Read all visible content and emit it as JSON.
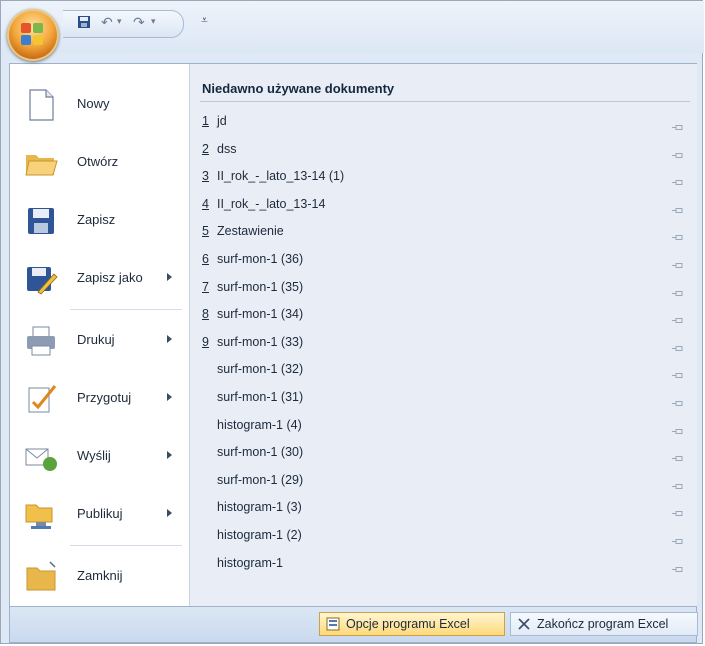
{
  "quick_access": {
    "save_icon": "floppy-disk-icon",
    "undo_icon": "undo-icon",
    "redo_icon": "redo-icon",
    "customize_icon": "customize-arrow-icon"
  },
  "commands": [
    {
      "label": "Nowy",
      "icon": "new-document-icon",
      "submenu": false
    },
    {
      "label": "Otwórz",
      "icon": "open-folder-icon",
      "submenu": false
    },
    {
      "label": "Zapisz",
      "icon": "save-icon",
      "submenu": false
    },
    {
      "label": "Zapisz jako",
      "icon": "save-as-icon",
      "submenu": true
    },
    {
      "label": "Drukuj",
      "icon": "printer-icon",
      "submenu": true
    },
    {
      "label": "Przygotuj",
      "icon": "prepare-icon",
      "submenu": true
    },
    {
      "label": "Wyślij",
      "icon": "send-icon",
      "submenu": true
    },
    {
      "label": "Publikuj",
      "icon": "publish-icon",
      "submenu": true
    },
    {
      "label": "Zamknij",
      "icon": "close-folder-icon",
      "submenu": false
    }
  ],
  "recent": {
    "title": "Niedawno używane dokumenty",
    "documents": [
      {
        "num": "1",
        "name": "jd"
      },
      {
        "num": "2",
        "name": "dss"
      },
      {
        "num": "3",
        "name": "II_rok_-_lato_13-14 (1)"
      },
      {
        "num": "4",
        "name": "II_rok_-_lato_13-14"
      },
      {
        "num": "5",
        "name": "Zestawienie"
      },
      {
        "num": "6",
        "name": "surf-mon-1 (36)"
      },
      {
        "num": "7",
        "name": "surf-mon-1 (35)"
      },
      {
        "num": "8",
        "name": "surf-mon-1 (34)"
      },
      {
        "num": "9",
        "name": "surf-mon-1 (33)"
      },
      {
        "num": "",
        "name": "surf-mon-1 (32)"
      },
      {
        "num": "",
        "name": "surf-mon-1 (31)"
      },
      {
        "num": "",
        "name": "histogram-1 (4)"
      },
      {
        "num": "",
        "name": "surf-mon-1 (30)"
      },
      {
        "num": "",
        "name": "surf-mon-1 (29)"
      },
      {
        "num": "",
        "name": "histogram-1 (3)"
      },
      {
        "num": "",
        "name": "histogram-1 (2)"
      },
      {
        "num": "",
        "name": "histogram-1"
      }
    ]
  },
  "footer": {
    "options_label": "Opcje programu Excel",
    "exit_label": "Zakończ program Excel"
  },
  "colors": {
    "accent": "#f3a63b",
    "pane_bg": "#e9eef6",
    "text": "#1d2a3b"
  }
}
